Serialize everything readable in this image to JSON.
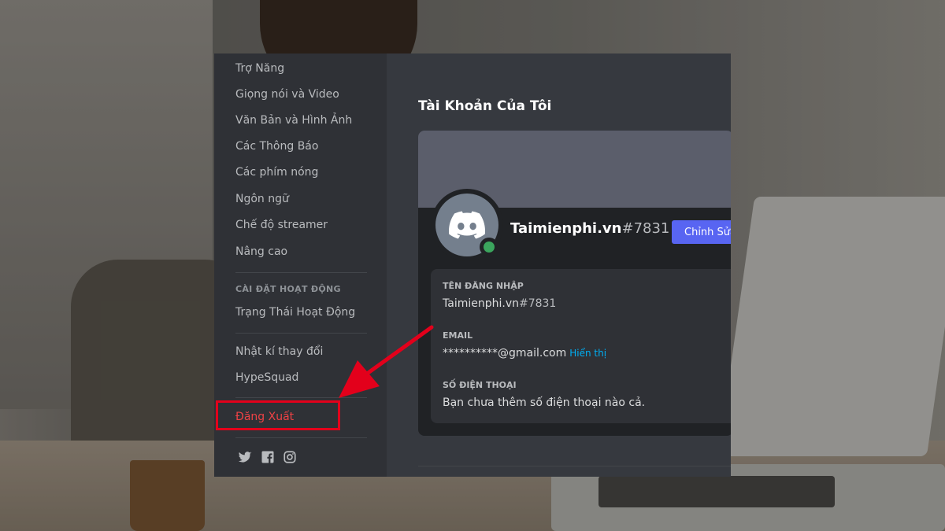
{
  "sidebar": {
    "items": [
      {
        "label": "Trợ Năng"
      },
      {
        "label": "Giọng nói và Video"
      },
      {
        "label": "Văn Bản và Hình Ảnh"
      },
      {
        "label": "Các Thông Báo"
      },
      {
        "label": "Các phím nóng"
      },
      {
        "label": "Ngôn ngữ"
      },
      {
        "label": "Chế độ streamer"
      },
      {
        "label": "Nâng cao"
      }
    ],
    "activity_header": "CÀI ĐẶT HOẠT ĐỘNG",
    "activity_status": "Trạng Thái Hoạt Động",
    "changelog": "Nhật kí thay đổi",
    "hypesquad": "HypeSquad",
    "logout": "Đăng Xuất",
    "social_icons": [
      "twitter-icon",
      "facebook-icon",
      "instagram-icon"
    ]
  },
  "main": {
    "title": "Tài Khoản Của Tôi",
    "profile": {
      "username": "Taimienphi.vn",
      "discriminator": "#7831",
      "edit_button": "Chỉnh Sửa"
    },
    "fields": {
      "username_label": "TÊN ĐĂNG NHẬP",
      "username_name": "Taimienphi.vn",
      "username_tag": "#7831",
      "email_label": "EMAIL",
      "email_value": "**********@gmail.com",
      "email_reveal": "Hiển thị",
      "phone_label": "SỐ ĐIỆN THOẠI",
      "phone_value": "Bạn chưa thêm số điện thoại nào cả."
    }
  },
  "colors": {
    "sidebar_bg": "#2f3136",
    "content_bg": "#36393f",
    "logout_red": "#ed4245",
    "brand_blurple": "#5865f2",
    "online_green": "#3ba55d",
    "annotation_red": "#e3001b"
  }
}
